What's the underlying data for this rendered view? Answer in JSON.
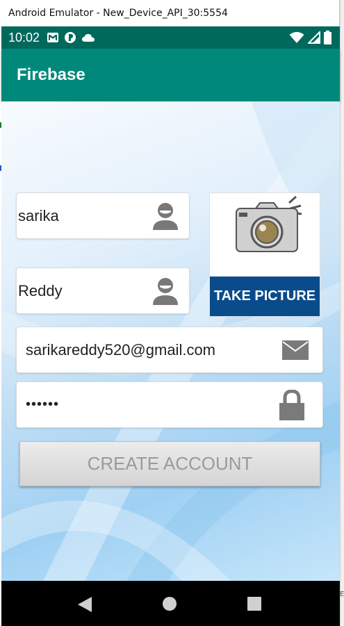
{
  "window": {
    "title": "Android Emulator - New_Device_API_30:5554",
    "edge_label": "E"
  },
  "status_bar": {
    "time": "10:02",
    "left_icons": [
      "gmail-icon",
      "play-protect-icon",
      "cloud-icon"
    ],
    "right_icons": [
      "wifi-icon",
      "signal-icon",
      "battery-icon"
    ]
  },
  "app_bar": {
    "title": "Firebase"
  },
  "form": {
    "first_name": "sarika",
    "last_name": "Reddy",
    "email": "sarikareddy520@gmail.com",
    "password": "••••••",
    "take_picture_label": "TAKE PICTURE",
    "create_account_label": "CREATE ACCOUNT"
  },
  "icons": {
    "first_name": "person-icon",
    "last_name": "person-icon",
    "email": "envelope-icon",
    "password": "lock-icon",
    "picture": "camera-icon"
  },
  "nav_bar": [
    "back-icon",
    "home-icon",
    "recents-icon"
  ],
  "colors": {
    "status_bar": "#00695c",
    "app_bar": "#00897b",
    "take_picture_band": "#0a4b8c",
    "button_text": "#9a9a9a"
  }
}
